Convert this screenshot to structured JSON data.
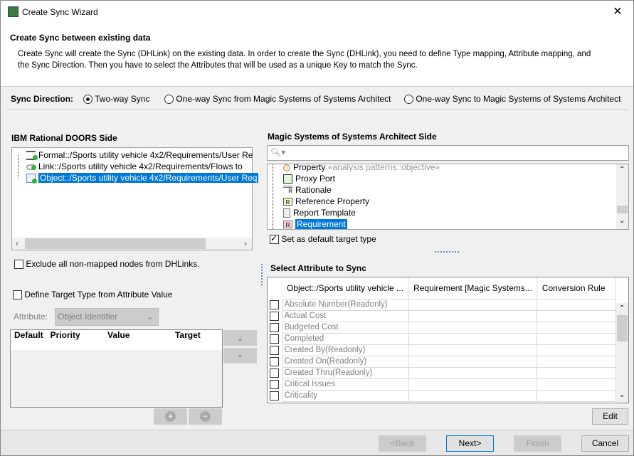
{
  "window": {
    "title": "Create Sync Wizard",
    "close": "✕"
  },
  "header": {
    "title": "Create Sync between existing data",
    "description": "Create Sync will create the Sync (DHLink) on the existing data. In order to create the Sync (DHLink), you need to define Type mapping, Attribute mapping, and the Sync Direction. Then you have to select the Attributes that will be used as a unique Key to match the Sync."
  },
  "sync_direction": {
    "label": "Sync Direction:",
    "options": [
      {
        "label": "Two-way Sync",
        "selected": true
      },
      {
        "label": "One-way Sync from Magic Systems of Systems Architect",
        "selected": false
      },
      {
        "label": "One-way Sync to Magic Systems of Systems Architect",
        "selected": false
      }
    ]
  },
  "doors": {
    "title": "IBM Rational DOORS Side",
    "items": [
      {
        "label": "Formal::/Sports utility vehicle 4x2/Requirements/User Re",
        "icon": "formal-module-icon"
      },
      {
        "label": "Link::/Sports utility vehicle 4x2/Requirements/Flows to",
        "icon": "link-module-icon"
      },
      {
        "label": "Object::/Sports utility vehicle 4x2/Requirements/User Req",
        "icon": "object-icon",
        "selected": true
      }
    ]
  },
  "exclude": {
    "label": "Exclude all non-mapped nodes from DHLinks.",
    "checked": false
  },
  "define_target": {
    "label": "Define Target Type from Attribute Value",
    "checked": false,
    "attribute_label": "Attribute:",
    "attribute_value": "Object Identifier",
    "columns": [
      "Default",
      "Priority",
      "Value",
      "Target"
    ]
  },
  "magic": {
    "title": "Magic Systems of Systems Architect Side",
    "search_placeholder": "",
    "items": [
      {
        "label": "Property",
        "stereotype": "«analysis patterns::objective»",
        "icon": "property-icon"
      },
      {
        "label": "Proxy Port",
        "icon": "proxy-port-icon"
      },
      {
        "label": "Rationale",
        "icon": "rationale-icon"
      },
      {
        "label": "Reference Property",
        "icon": "reference-property-icon"
      },
      {
        "label": "Report Template",
        "icon": "report-template-icon"
      },
      {
        "label": "Requirement",
        "icon": "requirement-icon",
        "selected": true
      }
    ],
    "default_target": {
      "label": "Set as default target type",
      "checked": true
    }
  },
  "attributes": {
    "title": "Select Attribute to Sync",
    "columns": [
      "Object::/Sports utility vehicle ...",
      "Requirement [Magic Systems...",
      "Conversion Rule"
    ],
    "rows": [
      "Absolute Number(Readonly)",
      "Actual Cost",
      "Budgeted Cost",
      "Completed",
      "Created By(Readonly)",
      "Created On(Readonly)",
      "Created Thru(Readonly)",
      "Critical Issues",
      "Criticality"
    ],
    "edit": "Edit"
  },
  "footer": {
    "back": "<Back",
    "next": "Next>",
    "finish": "Finish",
    "cancel": "Cancel"
  }
}
